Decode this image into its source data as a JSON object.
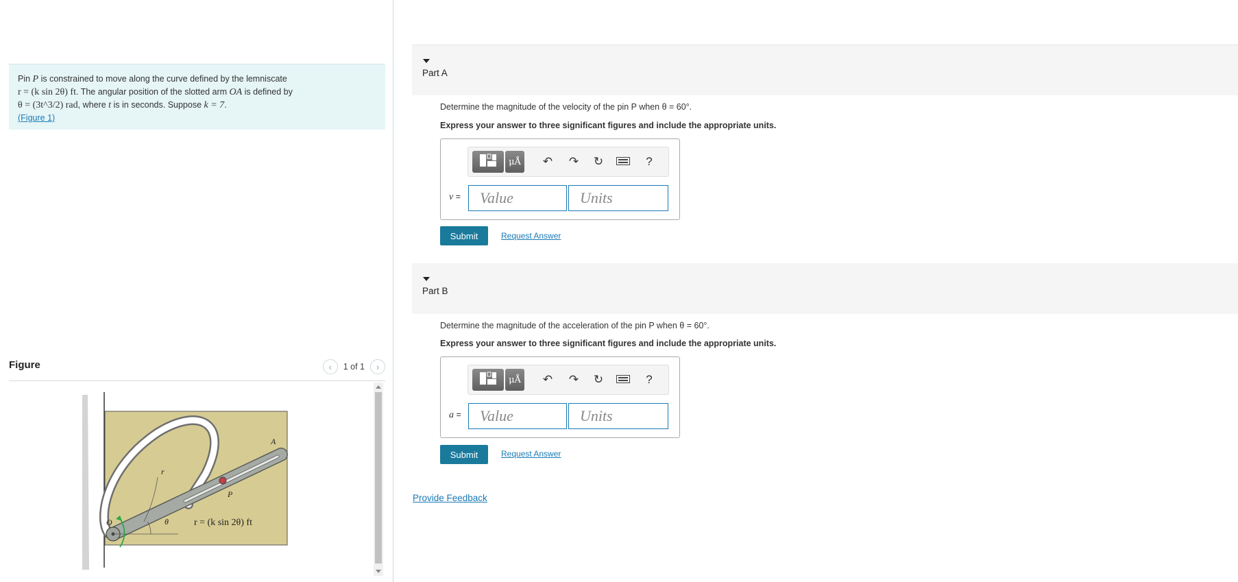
{
  "problem": {
    "line1_pre": "Pin ",
    "line1_var": "P",
    "line1_post": " is constrained to move along the curve defined by the lemniscate",
    "line2_eq": "r = (k sin 2θ) ft",
    "line2_post": ". The angular position of the slotted arm ",
    "line2_var": "OA",
    "line2_tail": " is defined by",
    "line3_eq": "θ = (3t^3/2) rad",
    "line3_mid": ", where ",
    "line3_t": "t",
    "line3_post": " is in seconds. Suppose ",
    "line3_k": "k = 7",
    "line3_end": ".",
    "figure_link": "(Figure 1)"
  },
  "figure": {
    "title": "Figure",
    "counter": "1 of 1",
    "labels": {
      "A": "A",
      "P": "P",
      "r": "r",
      "O": "O",
      "theta": "θ",
      "equation": "r = (k sin 2θ) ft"
    },
    "colors": {
      "plate": "#d6cc93",
      "arm": "#9ea39d",
      "pin": "#c0404a",
      "arrow": "#2aa84a"
    }
  },
  "parts": [
    {
      "title": "Part A",
      "question": "Determine the magnitude of the velocity of the pin P when θ = 60°.",
      "instruction": "Express your answer to three significant figures and include the appropriate units.",
      "variable": "v",
      "value_placeholder": "Value",
      "units_placeholder": "Units",
      "submit_label": "Submit",
      "request_label": "Request Answer"
    },
    {
      "title": "Part B",
      "question": "Determine the magnitude of the acceleration of the pin P when θ = 60°.",
      "instruction": "Express your answer to three significant figures and include the appropriate units.",
      "variable": "a",
      "value_placeholder": "Value",
      "units_placeholder": "Units",
      "submit_label": "Submit",
      "request_label": "Request Answer"
    }
  ],
  "toolbar": {
    "units_button": "μÅ",
    "help": "?",
    "icons": [
      "templates-icon",
      "units-icon",
      "undo-icon",
      "redo-icon",
      "reset-icon",
      "keyboard-icon",
      "help-icon"
    ]
  },
  "feedback_label": "Provide Feedback"
}
